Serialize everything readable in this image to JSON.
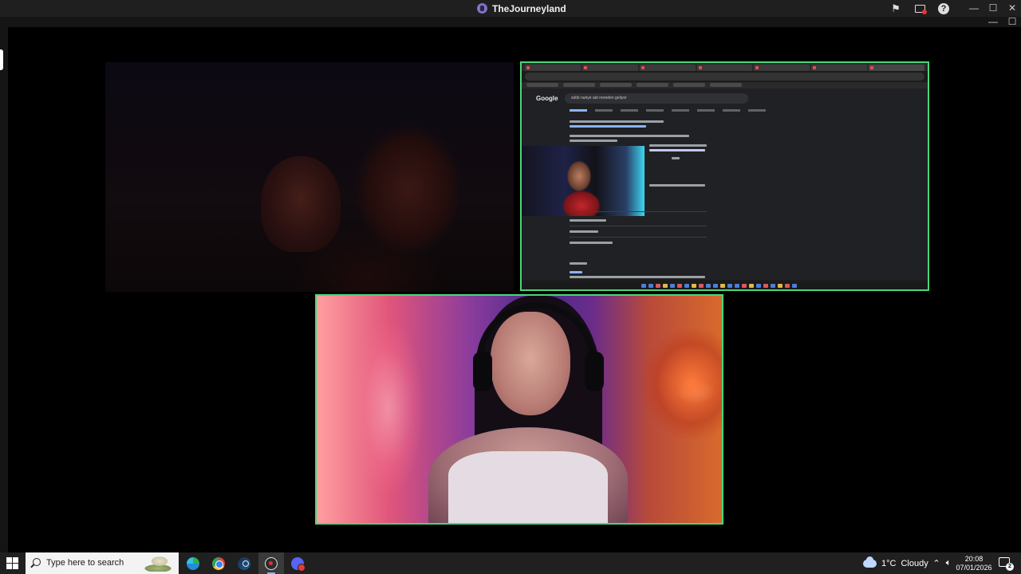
{
  "window": {
    "title": "TheJourneyland",
    "controls": {
      "minimize": "—",
      "maximize": "☐",
      "close": "✕"
    }
  },
  "toolbar": {
    "icons": [
      "flag-icon",
      "screen-share-icon",
      "help-icon"
    ],
    "help_label": "?"
  },
  "screen_share": {
    "browser_brand": "Google",
    "search_query": "sütlü nuriye adı nereden geliyor"
  },
  "taskbar": {
    "search_placeholder": "Type here to search",
    "pinned_apps": [
      "edge-icon",
      "chrome-icon",
      "steam-icon",
      "obs-icon",
      "discord-icon"
    ],
    "active_app": "obs-icon",
    "weather": {
      "temp": "1°C",
      "condition": "Cloudy"
    },
    "clock": {
      "time": "20:08",
      "date": "07/01/2026"
    },
    "notification_count": "2"
  },
  "colors": {
    "accent_border": "#48d67a",
    "titlebar_bg": "#1f1f1f",
    "taskbar_bg": "#202020"
  }
}
